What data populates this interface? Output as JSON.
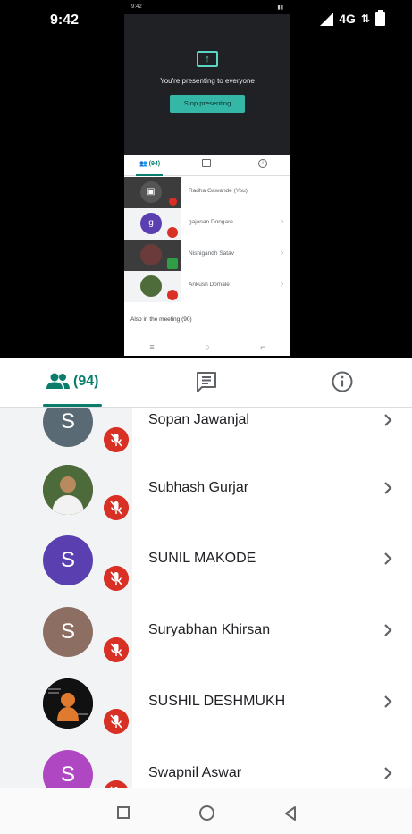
{
  "status_bar": {
    "time": "9:42",
    "network": "4G"
  },
  "inner_screen": {
    "status_time": "9:42",
    "presenting_text": "You're presenting to everyone",
    "stop_button": "Stop presenting",
    "people_count": "(94)",
    "participants": [
      {
        "name": "Radha Gawande (You)",
        "initial": ""
      },
      {
        "name": "gajanan Dongare",
        "initial": "g"
      },
      {
        "name": "Nishigandh Satav",
        "initial": ""
      },
      {
        "name": "Ankush Domale",
        "initial": ""
      }
    ],
    "also_in_meeting": "Also in the meeting (90)"
  },
  "tabs": {
    "people_count": "(94)"
  },
  "participants": [
    {
      "name": "Sopan Jawanjal",
      "initial": "S",
      "color": "#596a74"
    },
    {
      "name": "Subhash Gurjar",
      "initial": "",
      "color": "#7b6a4e"
    },
    {
      "name": "SUNIL MAKODE",
      "initial": "S",
      "color": "#5a3fb0"
    },
    {
      "name": "Suryabhan Khirsan",
      "initial": "S",
      "color": "#8d6e63"
    },
    {
      "name": "SUSHIL DESHMUKH",
      "initial": "",
      "color": "#1a1a1a"
    },
    {
      "name": "Swapnil Aswar",
      "initial": "S",
      "color": "#b047c2"
    }
  ],
  "colors": {
    "accent": "#0b7d6d",
    "mute": "#d93025"
  },
  "icons": [
    "people-icon",
    "chat-icon",
    "info-icon",
    "mic-off-icon",
    "chevron-right-icon"
  ]
}
